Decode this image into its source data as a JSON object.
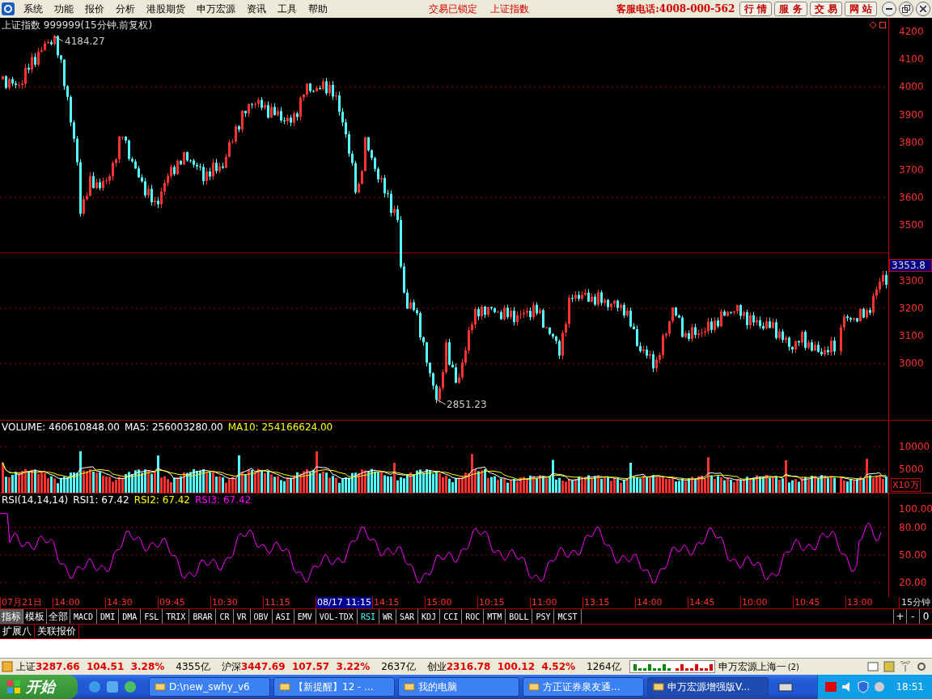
{
  "menu": {
    "items": [
      "系统",
      "功能",
      "报价",
      "分析",
      "港股期货",
      "申万宏源",
      "资讯",
      "工具",
      "帮助"
    ],
    "status": [
      "交易已锁定",
      "上证指数"
    ],
    "hotline": "客服电话:4008-000-562",
    "buttons": [
      "行 情",
      "服 务",
      "交 易",
      "网 站"
    ]
  },
  "chart": {
    "title": "上证指数 999999(15分钟.前复权)",
    "high_label": "4184.27",
    "low_label": "2851.23",
    "price_ticks": [
      "4200",
      "4100",
      "4000",
      "3900",
      "3800",
      "3700",
      "3600",
      "3500",
      "3300",
      "3200",
      "3100",
      "3000"
    ],
    "current_price": "3353.8"
  },
  "volume": {
    "legend": [
      {
        "text": "VOLUME: 460610848.00",
        "color": "#ffffff"
      },
      {
        "text": "MA5: 256003280.00",
        "color": "#ffffff"
      },
      {
        "text": "MA10: 254166624.00",
        "color": "#ffff00"
      }
    ],
    "ticks": [
      "10000",
      "5000"
    ],
    "unit": "X10万"
  },
  "rsi": {
    "legend": [
      {
        "text": "RSI(14,14,14)",
        "color": "#ffffff"
      },
      {
        "text": "RSI1: 67.42",
        "color": "#ffffff"
      },
      {
        "text": "RSI2: 67.42",
        "color": "#ffff00"
      },
      {
        "text": "RSI3: 67.42",
        "color": "#ff00ff"
      }
    ],
    "ticks": [
      "100.00",
      "80.00",
      "50.00",
      "20.00"
    ]
  },
  "time_axis": {
    "labels": [
      {
        "text": "07月21日",
        "selected": false
      },
      {
        "text": "14:00",
        "selected": false
      },
      {
        "text": "14:30",
        "selected": false
      },
      {
        "text": "09:45",
        "selected": false
      },
      {
        "text": "10:30",
        "selected": false
      },
      {
        "text": "11:15",
        "selected": false
      },
      {
        "text": "08/17 11:15",
        "selected": true
      },
      {
        "text": "14:15",
        "selected": false
      },
      {
        "text": "15:00",
        "selected": false
      },
      {
        "text": "10:15",
        "selected": false
      },
      {
        "text": "11:00",
        "selected": false
      },
      {
        "text": "13:15",
        "selected": false
      },
      {
        "text": "14:00",
        "selected": false
      },
      {
        "text": "14:45",
        "selected": false
      },
      {
        "text": "10:00",
        "selected": false
      },
      {
        "text": "10:45",
        "selected": false
      },
      {
        "text": "13:00",
        "selected": false
      }
    ],
    "period": "15分钟"
  },
  "view_tabs": [
    {
      "label": "指标",
      "selected": true
    },
    {
      "label": "模板",
      "selected": false
    },
    {
      "label": "全部",
      "selected": false
    }
  ],
  "indicators": [
    {
      "label": "MACD",
      "selected": false
    },
    {
      "label": "DMI",
      "selected": false
    },
    {
      "label": "DMA",
      "selected": false
    },
    {
      "label": "FSL",
      "selected": false
    },
    {
      "label": "TRIX",
      "selected": false
    },
    {
      "label": "BRAR",
      "selected": false
    },
    {
      "label": "CR",
      "selected": false
    },
    {
      "label": "VR",
      "selected": false
    },
    {
      "label": "OBV",
      "selected": false
    },
    {
      "label": "ASI",
      "selected": false
    },
    {
      "label": "EMV",
      "selected": false
    },
    {
      "label": "VOL-TDX",
      "selected": false
    },
    {
      "label": "RSI",
      "selected": true
    },
    {
      "label": "WR",
      "selected": false
    },
    {
      "label": "SAR",
      "selected": false
    },
    {
      "label": "KDJ",
      "selected": false
    },
    {
      "label": "CCI",
      "selected": false
    },
    {
      "label": "ROC",
      "selected": false
    },
    {
      "label": "MTM",
      "selected": false
    },
    {
      "label": "BOLL",
      "selected": false
    },
    {
      "label": "PSY",
      "selected": false
    },
    {
      "label": "MCST",
      "selected": false
    }
  ],
  "zoom_buttons": [
    "+",
    "-",
    "0"
  ],
  "bottom_tabs": [
    "扩展八",
    "关联报价"
  ],
  "status_bar": {
    "indices": [
      {
        "name": "上证",
        "value": "3287.66",
        "change": "104.51",
        "percent": "3.28%",
        "turnover": "4355亿"
      },
      {
        "name": "沪深",
        "value": "3447.69",
        "change": "107.57",
        "percent": "3.22%",
        "turnover": "2637亿"
      },
      {
        "name": "创业",
        "value": "2316.78",
        "change": "100.12",
        "percent": "4.52%",
        "turnover": "1264亿"
      }
    ],
    "server": "申万宏源上海一",
    "server_count": "(2)"
  },
  "taskbar": {
    "start": "开始",
    "windows": [
      {
        "title": "D:\\new_swhy_v6",
        "selected": false
      },
      {
        "title": "【新提醒】12 - ...",
        "selected": false
      },
      {
        "title": "我的电脑",
        "selected": false
      },
      {
        "title": "方正证券泉友通...",
        "selected": false
      },
      {
        "title": "申万宏源增强版V...",
        "selected": true
      }
    ],
    "clock": "18:51"
  }
}
